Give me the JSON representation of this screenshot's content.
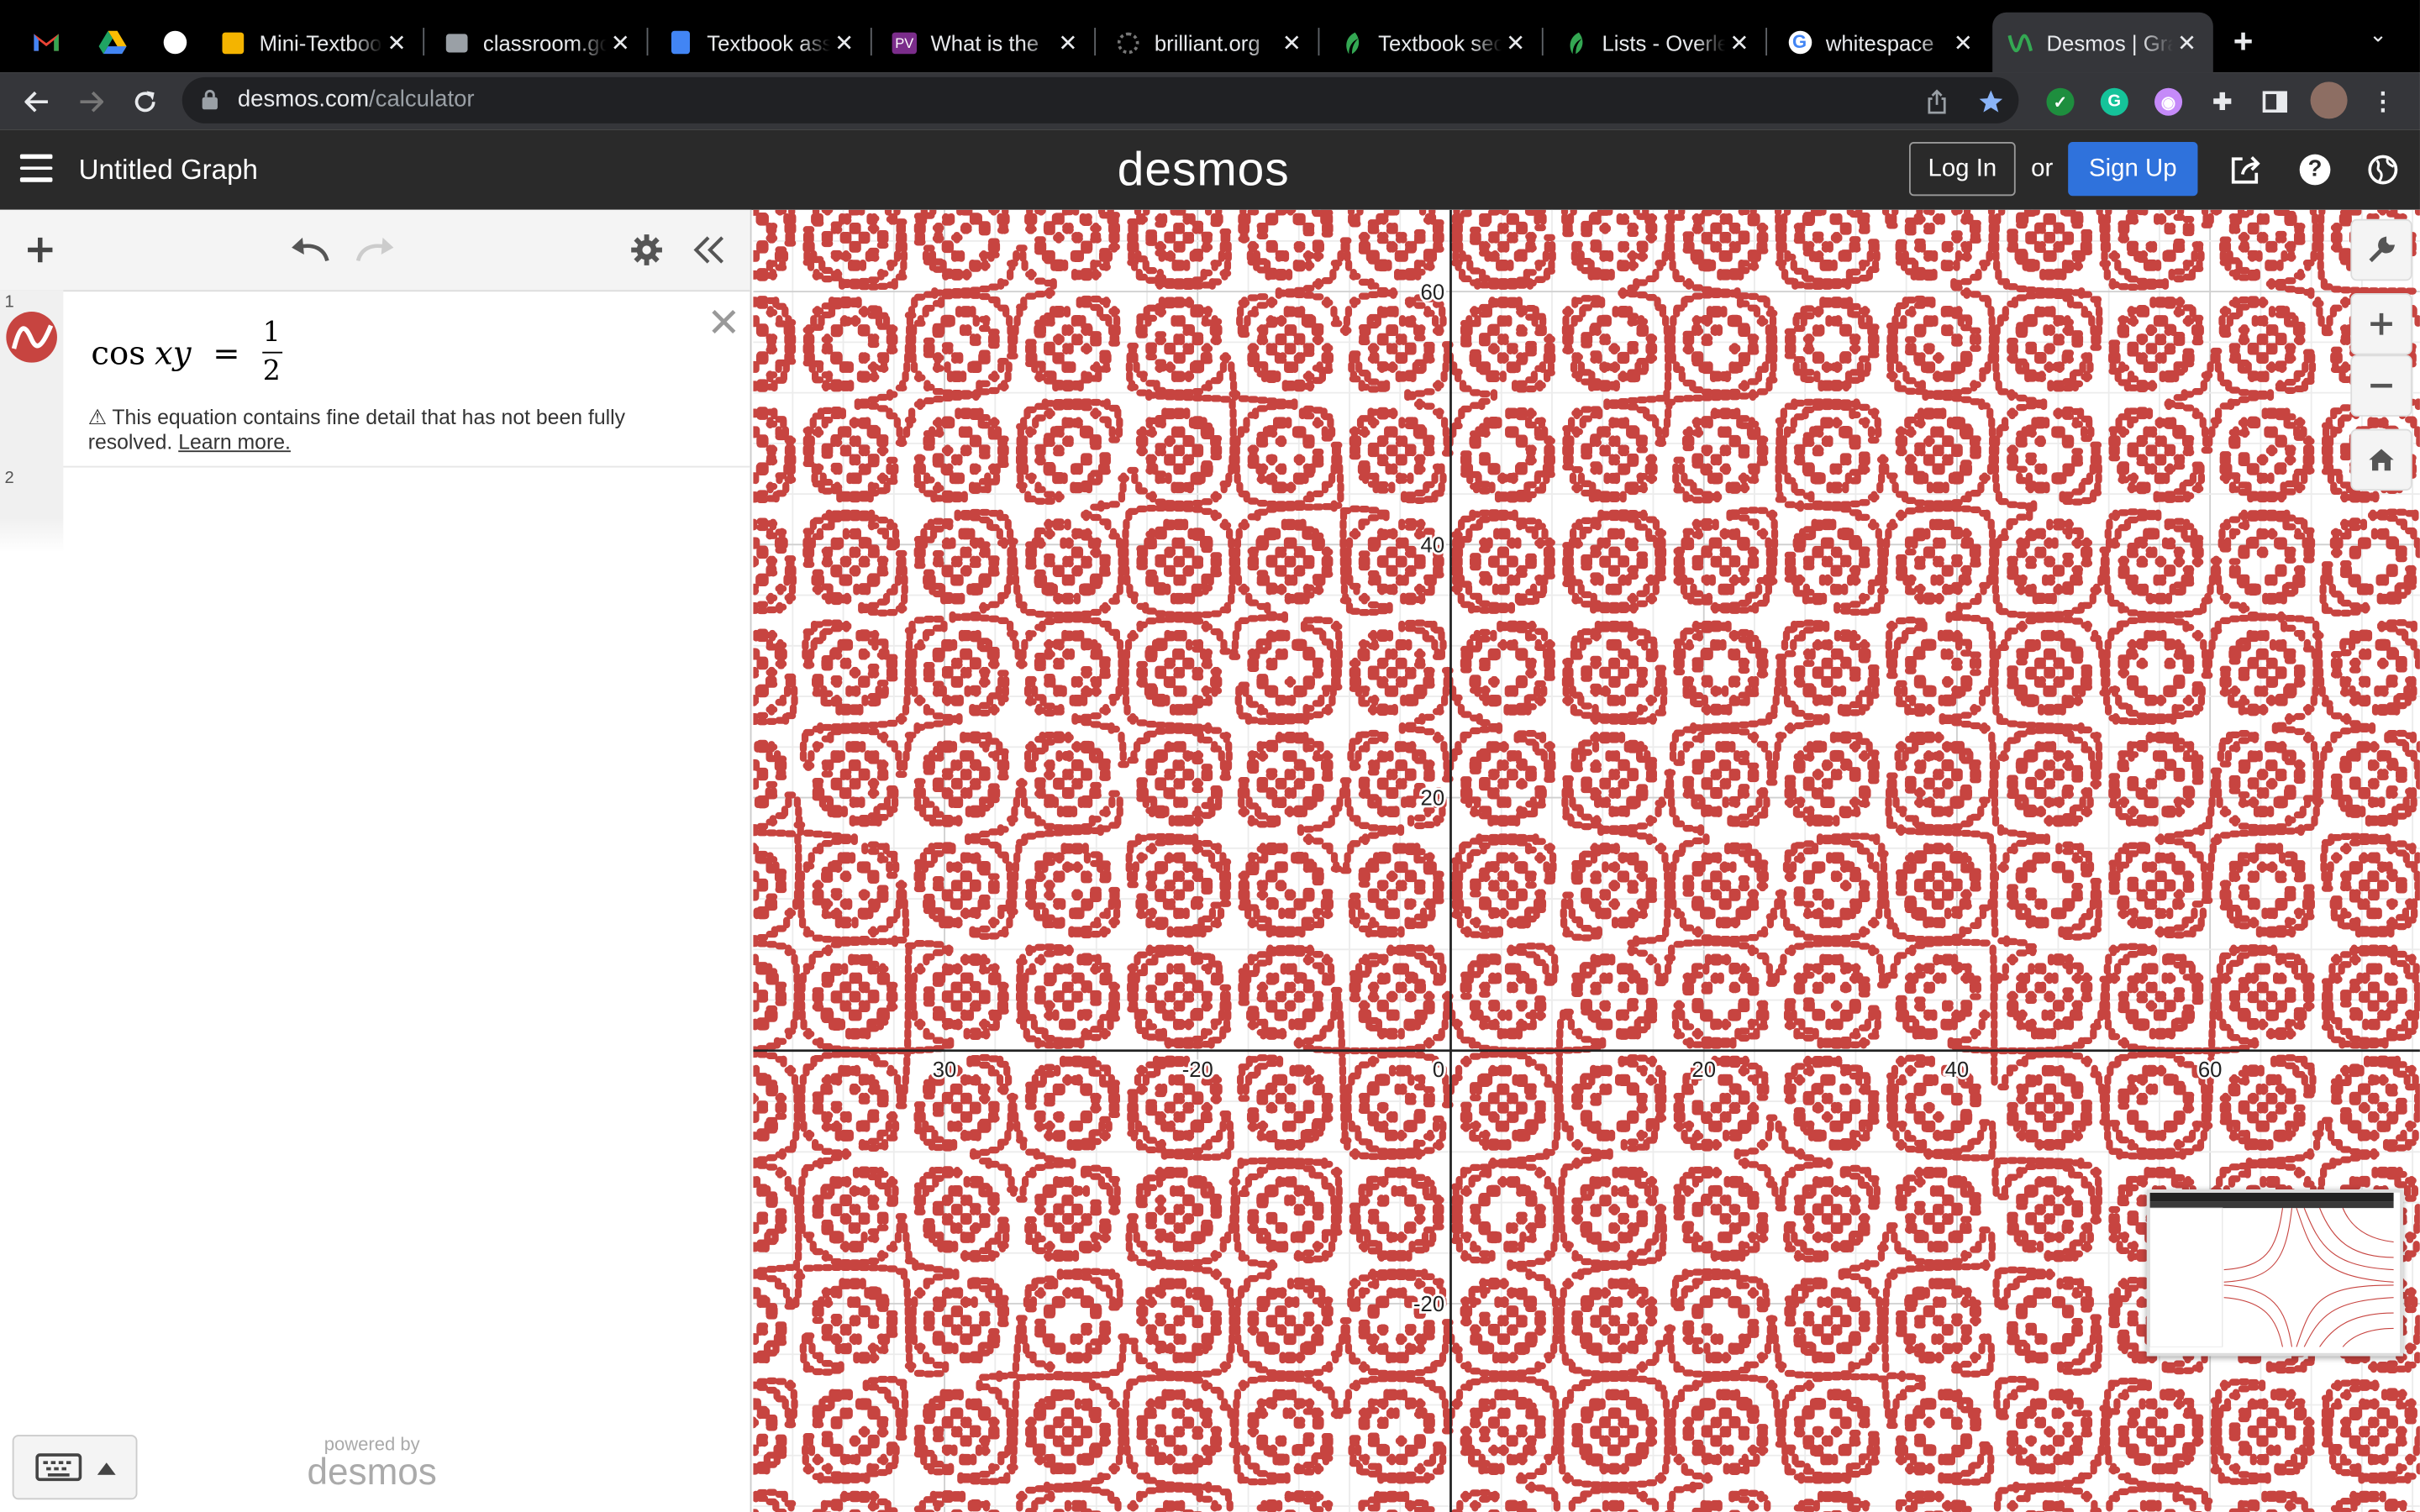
{
  "browser": {
    "tabs": [
      {
        "title": "",
        "icon": "gmail-icon",
        "color": "#ea4335"
      },
      {
        "title": "",
        "icon": "drive-icon",
        "color": "#1fa463"
      },
      {
        "title": "",
        "icon": "circle-icon",
        "color": "#ffffff"
      },
      {
        "title": "Mini-Textbook",
        "icon": "slides-icon",
        "color": "#f4b400"
      },
      {
        "title": "classroom.google",
        "icon": "classroom-icon",
        "color": "#9aa0a6"
      },
      {
        "title": "Textbook assignment",
        "icon": "docs-icon",
        "color": "#4285f4"
      },
      {
        "title": "What is the",
        "icon": "vid-icon",
        "color": "#7b2d8b"
      },
      {
        "title": "brilliant.org",
        "icon": "brilliant-icon",
        "color": "#555"
      },
      {
        "title": "Textbook section",
        "icon": "leaf-icon",
        "color": "#34a853"
      },
      {
        "title": "Lists - Overleaf",
        "icon": "leaf-icon",
        "color": "#34a853"
      },
      {
        "title": "whitespace",
        "icon": "google-icon",
        "color": "#4285f4"
      },
      {
        "title": "Desmos | Graphing Calculator",
        "icon": "desmos-icon",
        "color": "#34a853"
      }
    ],
    "url_host": "desmos.com",
    "url_path": "/calculator"
  },
  "header": {
    "graph_title": "Untitled Graph",
    "logo": "desmos",
    "login_label": "Log In",
    "or_label": "or",
    "signup_label": "Sign Up"
  },
  "expressions": [
    {
      "index": "1",
      "fn": "cos",
      "var": "xy",
      "eq": "=",
      "numerator": "1",
      "denominator": "2",
      "color": "#c74440",
      "warning_icon": "⚠",
      "warning_text": "This equation contains fine detail that has not been fully resolved.",
      "learn_more": "Learn more."
    },
    {
      "index": "2"
    }
  ],
  "footer": {
    "powered_by": "powered by",
    "brand": "desmos"
  },
  "graph": {
    "x_ticks": [
      "-20",
      "0",
      "20",
      "40",
      "60"
    ],
    "x_tick_partial": "30",
    "y_ticks": [
      "60",
      "40",
      "20",
      "-20"
    ],
    "curve_color": "#c74440"
  }
}
